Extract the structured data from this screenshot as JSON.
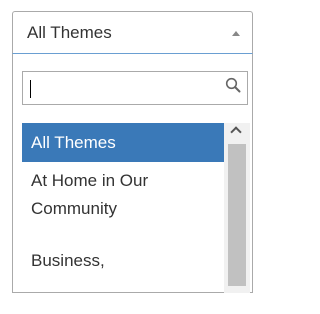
{
  "select": {
    "value": "All Themes"
  },
  "search": {
    "value": "",
    "placeholder": ""
  },
  "options": [
    {
      "label": "All Themes",
      "selected": true
    },
    {
      "label": "At Home in Our\nCommunity",
      "selected": false
    },
    {
      "label": "Business,",
      "selected": false
    }
  ],
  "colors": {
    "selected_bg": "#3a79b8",
    "focus_border": "#6a9fd2"
  },
  "icons": {
    "caret": "caret-up-icon",
    "search": "search-icon",
    "scroll_up": "chevron-up-icon"
  }
}
